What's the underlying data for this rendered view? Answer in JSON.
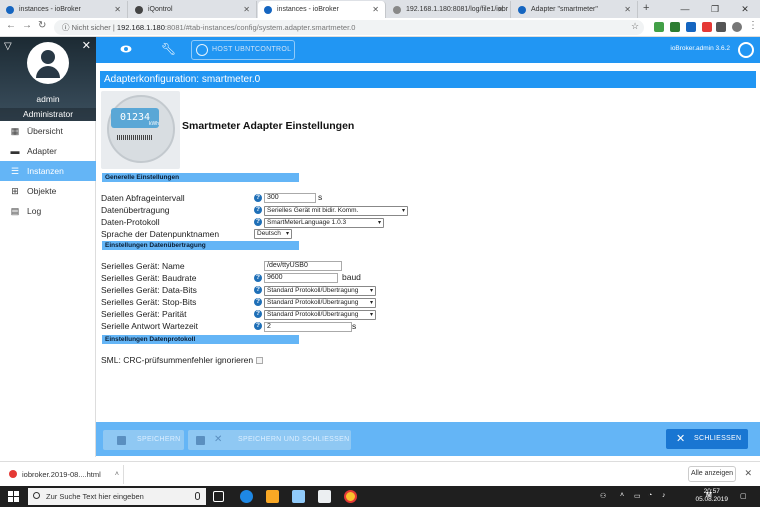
{
  "browser": {
    "tabs": [
      {
        "title": "instances - ioBroker",
        "active": false,
        "color": "#1565c0"
      },
      {
        "title": "iQontrol",
        "active": false,
        "color": "#444"
      },
      {
        "title": "instances - ioBroker",
        "active": true,
        "color": "#1565c0"
      },
      {
        "title": "192.168.1.180:8081/log/file1/iobr",
        "active": false,
        "color": "#888"
      },
      {
        "title": "Adapter \"smartmeter\"",
        "active": false,
        "color": "#1565c0"
      }
    ],
    "window_controls": {
      "minimize": "—",
      "maximize": "❐",
      "close": "✕"
    },
    "address": {
      "not_secure": "Nicht sicher",
      "separator": "|",
      "host": "192.168.1.180",
      "path": ":8081/#tab-instances/config/system.adapter.smartmeter.0"
    }
  },
  "sidebar": {
    "user": "admin",
    "role": "Administrator",
    "items": [
      {
        "label": "Übersicht",
        "icon": "grid-icon",
        "glyph": "▦",
        "active": false
      },
      {
        "label": "Adapter",
        "icon": "store-icon",
        "glyph": "▬",
        "active": false
      },
      {
        "label": "Instanzen",
        "icon": "list-icon",
        "glyph": "☰",
        "active": true
      },
      {
        "label": "Objekte",
        "icon": "tree-icon",
        "glyph": "⊞",
        "active": false
      },
      {
        "label": "Log",
        "icon": "log-icon",
        "glyph": "▤",
        "active": false
      }
    ]
  },
  "topbar": {
    "host_button": "HOST UBNTCONTROL",
    "version": "ioBroker.admin 3.6.2"
  },
  "config": {
    "title": "Adapterkonfiguration: smartmeter.0",
    "heading": "Smartmeter Adapter Einstellungen",
    "meter_reading": "01234",
    "meter_unit": "kWh",
    "sections": {
      "general": "Generelle Einstellungen",
      "transfer": "Einstellungen Datenübertragung",
      "protocol": "Einstellungen Datenprotokoll"
    },
    "fields": {
      "interval_label": "Daten Abfrageintervall",
      "interval_value": "300",
      "interval_unit": "s",
      "transfer_label": "Datenübertragung",
      "transfer_value": "Serielles Gerät mit bidir. Komm.",
      "protocol_label": "Daten-Protokoll",
      "protocol_value": "SmartMeterLanguage 1.0.3",
      "lang_label": "Sprache der Datenpunktnamen",
      "lang_value": "Deutsch",
      "serial_name_label": "Serielles Gerät: Name",
      "serial_name_value": "/dev/ttyUSB0",
      "baud_label": "Serielles Gerät: Baudrate",
      "baud_value": "9600",
      "baud_unit": "baud",
      "databits_label": "Serielles Gerät: Data-Bits",
      "databits_value": "Standard Protokoll/Übertragung",
      "stopbits_label": "Serielles Gerät: Stop-Bits",
      "stopbits_value": "Standard Protokoll/Übertragung",
      "parity_label": "Serielles Gerät: Parität",
      "parity_value": "Standard Protokoll/Übertragung",
      "wait_label": "Serielle Antwort Wartezeit",
      "wait_value": "2",
      "wait_unit": "s",
      "crc_label": "SML: CRC-prüfsummenfehler ignorieren"
    }
  },
  "footer": {
    "save": "SPEICHERN",
    "save_close": "SPEICHERN UND SCHLIESSEN",
    "close": "SCHLIESSEN"
  },
  "downloads": {
    "file": "iobroker.2019-08....html",
    "show_all": "Alle anzeigen"
  },
  "taskbar": {
    "search_placeholder": "Zur Suche Text hier eingeben",
    "time": "20:57",
    "date": "05.08.2019"
  }
}
